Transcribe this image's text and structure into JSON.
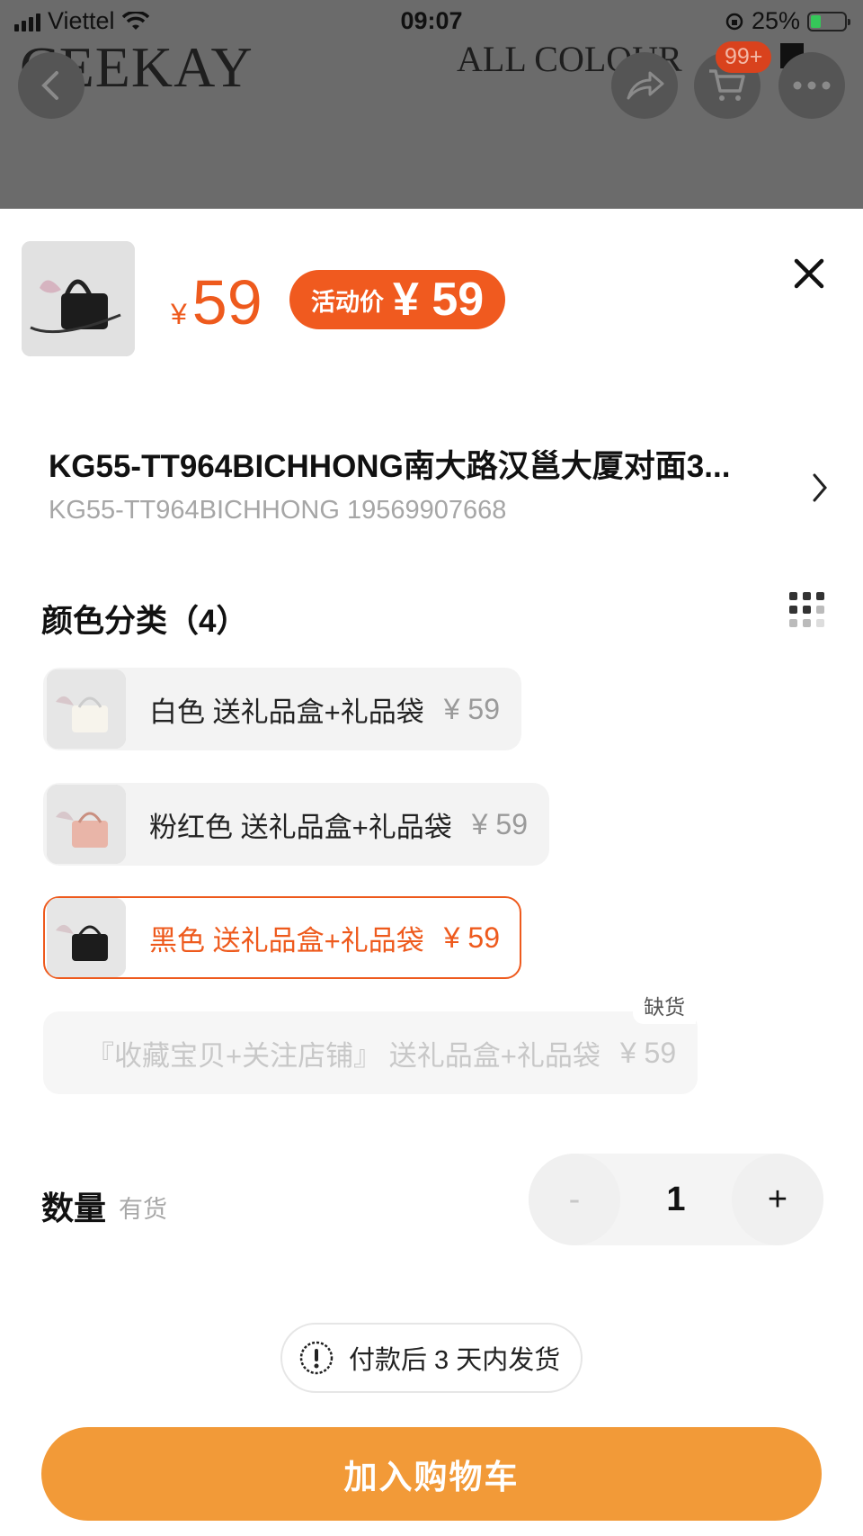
{
  "status_bar": {
    "carrier": "Viettel",
    "time": "09:07",
    "battery": "25%"
  },
  "backdrop": {
    "brand": "CEEKAY",
    "colour_text": "ALL COLOUR",
    "cart_badge": "99+"
  },
  "sheet": {
    "price_currency": "¥",
    "price": "59",
    "promo_label": "活动价",
    "promo_price": "¥ 59",
    "address_title": "KG55-TT964BICHHONG南大路汉邕大厦对面3...",
    "address_sub": "KG55-TT964BICHHONG 19569907668",
    "color_section_title": "颜色分类（4）",
    "options": [
      {
        "label": "白色 送礼品盒+礼品袋",
        "price": "¥ 59",
        "state": "normal"
      },
      {
        "label": "粉红色 送礼品盒+礼品袋",
        "price": "¥ 59",
        "state": "normal"
      },
      {
        "label": "黑色 送礼品盒+礼品袋",
        "price": "¥ 59",
        "state": "selected"
      },
      {
        "label": "『收藏宝贝+关注店铺』 送礼品盒+礼品袋",
        "price": "¥ 59",
        "state": "out_of_stock",
        "tag": "缺货"
      }
    ],
    "quantity_label": "数量",
    "stock_status": "有货",
    "quantity_value": "1",
    "minus": "-",
    "plus": "+",
    "shipping_notice": "付款后 3 天内发货",
    "add_to_cart": "加入购物车"
  },
  "colors": {
    "accent": "#ee5a1d",
    "cart_button": "#f29a38"
  },
  "icons": [
    "back-icon",
    "share-icon",
    "cart-icon",
    "more-icon",
    "close-icon",
    "chevron-right-icon",
    "grid-view-icon",
    "info-icon"
  ]
}
